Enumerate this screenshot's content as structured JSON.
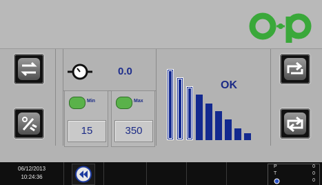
{
  "logo": {
    "text": "op",
    "color": "#3aa83a"
  },
  "left_buttons": [
    {
      "name": "swap-arrows",
      "icon": "swap-arrows-icon"
    },
    {
      "name": "tools",
      "icon": "tools-icon"
    }
  ],
  "right_buttons": [
    {
      "name": "cycle-forward",
      "icon": "cycle-forward-icon"
    },
    {
      "name": "cycle-loop",
      "icon": "cycle-loop-icon"
    }
  ],
  "pump": {
    "icon": "flow-sensor-icon",
    "value": "0.0"
  },
  "min": {
    "label": "Min",
    "icon": "gauge-icon",
    "value": "15"
  },
  "max": {
    "label": "Max",
    "icon": "gauge-icon",
    "value": "350"
  },
  "level": {
    "status": "OK",
    "bar_color": "#13298f",
    "bars": [
      {
        "level": 0.83,
        "highlighted": true
      },
      {
        "level": 0.73,
        "highlighted": true
      },
      {
        "level": 0.63,
        "highlighted": true
      },
      {
        "level": 0.53,
        "highlighted": false
      },
      {
        "level": 0.43,
        "highlighted": false
      },
      {
        "level": 0.34,
        "highlighted": false
      },
      {
        "level": 0.24,
        "highlighted": false
      },
      {
        "level": 0.14,
        "highlighted": false
      },
      {
        "level": 0.08,
        "highlighted": false
      }
    ]
  },
  "footer": {
    "date": "06/12/2013",
    "time": "10:24:36",
    "back_icon": "rewind-icon",
    "counters": [
      {
        "key": "P",
        "value": "0"
      },
      {
        "key": "T",
        "value": "0"
      },
      {
        "key": "clock",
        "value": "0"
      }
    ]
  }
}
